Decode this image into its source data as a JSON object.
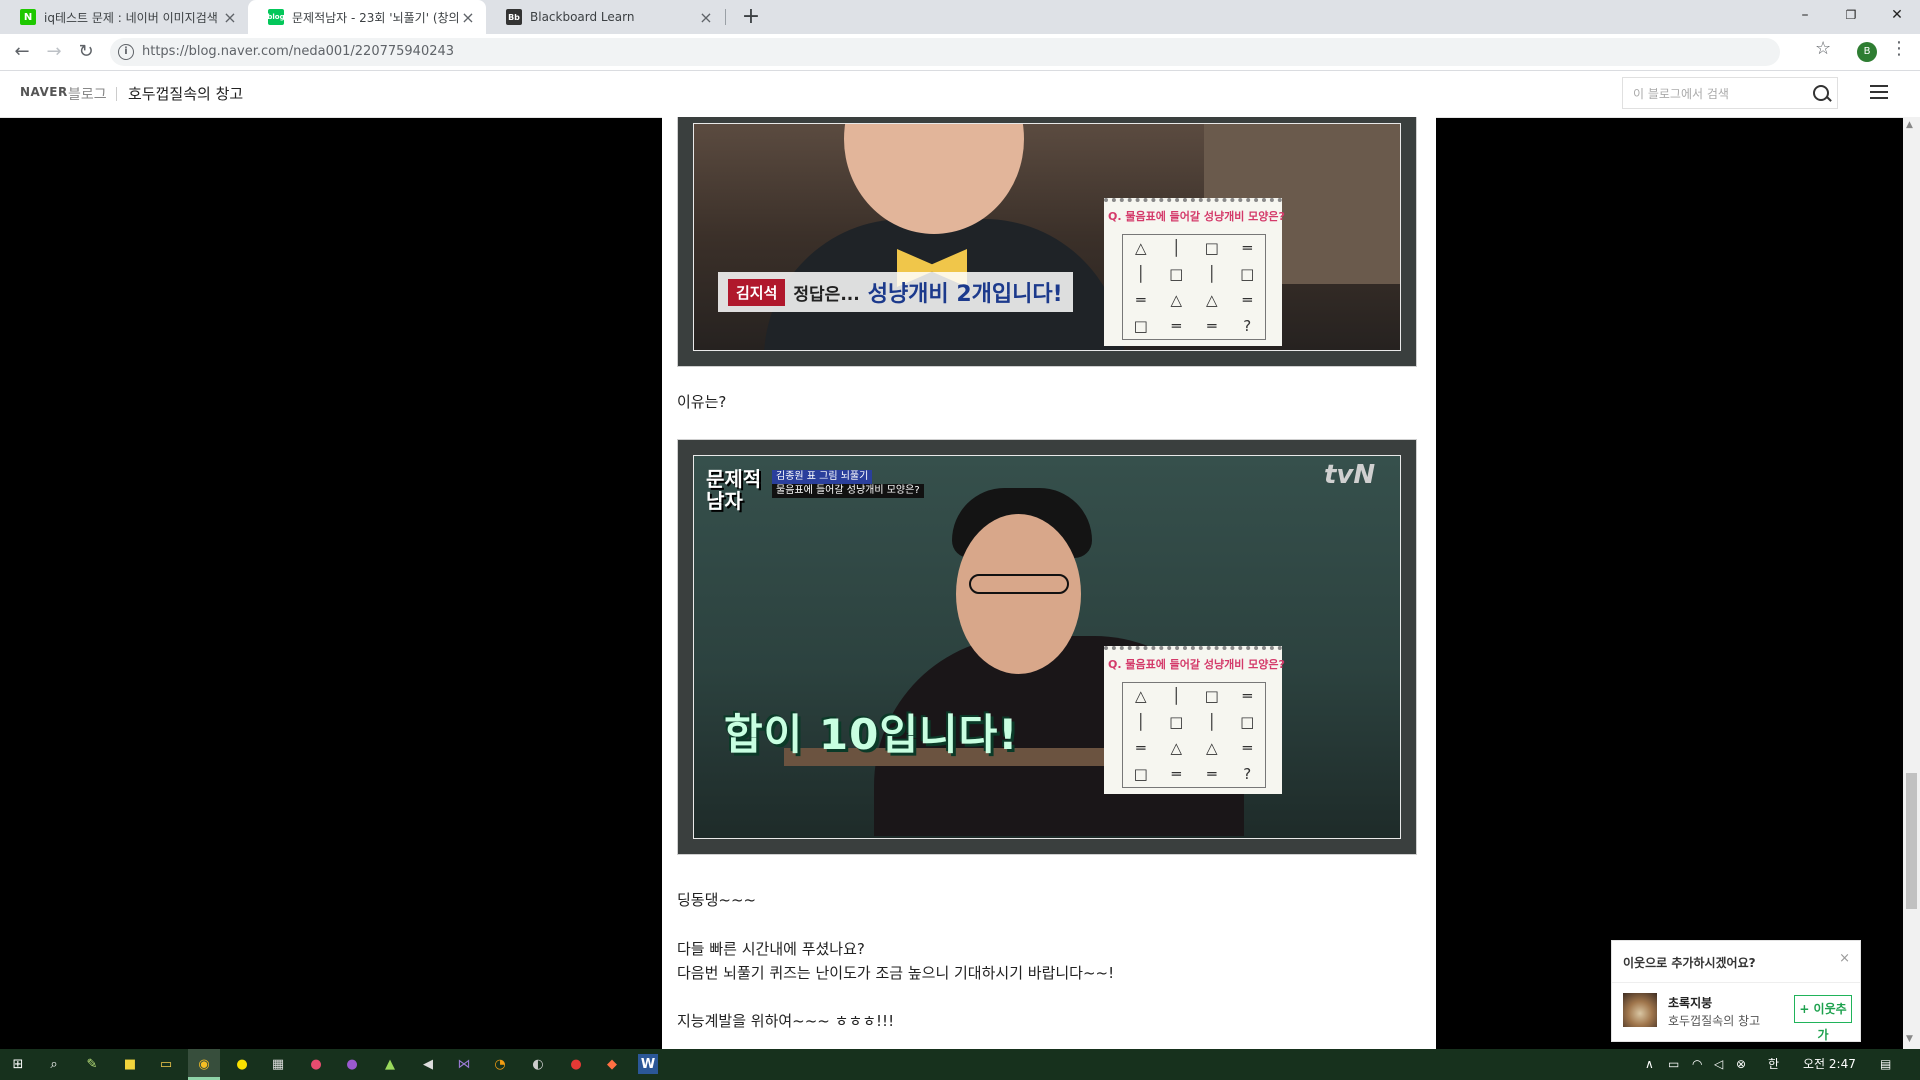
{
  "browser": {
    "tabs": [
      {
        "title": "iq테스트 문제 : 네이버 이미지검색",
        "favicon": "naver-n-icon"
      },
      {
        "title": "문제적남자 - 23회 '뇌풀기' (창의",
        "favicon": "naver-blog-icon"
      },
      {
        "title": "Blackboard Learn",
        "favicon": "blackboard-icon"
      }
    ],
    "new_tab": "+",
    "url": "https://blog.naver.com/neda001/220775940243",
    "profile_initial": "B",
    "window_controls": {
      "minimize": "–",
      "restore": "❐",
      "close": "✕"
    }
  },
  "blog_header": {
    "logo": "NAVER",
    "logo_sub": "블로그",
    "title": "호두껍질속의 창고",
    "search_placeholder": "이 블로그에서 검색"
  },
  "post": {
    "image1": {
      "caption_name": "김지석",
      "caption_prefix": "정답은...",
      "caption_text": "성냥개비 2개입니다!",
      "quiz_title": "물음표에 들어갈 성냥개비 모양은?",
      "quiz_q_mark": "Q.",
      "quiz_cells": [
        "△",
        "│",
        "□",
        "═",
        "│",
        "□",
        "│",
        "□",
        "═",
        "△",
        "△",
        "═",
        "□",
        "═",
        "═",
        "?"
      ]
    },
    "text1": "이유는?",
    "image2": {
      "show_logo_line1": "문제적",
      "show_logo_line2": "남자",
      "caption_top": "김종원 표 그림 뇌풀기",
      "caption_bottom": "물음표에 들어갈 성냥개비 모양은?",
      "channel": "tvN",
      "subtitle": "합이 10입니다!",
      "quiz_title": "물음표에 들어갈 성냥개비 모양은?",
      "quiz_q_mark": "Q.",
      "quiz_cells": [
        "△",
        "│",
        "□",
        "═",
        "│",
        "□",
        "│",
        "□",
        "═",
        "△",
        "△",
        "═",
        "□",
        "═",
        "═",
        "?"
      ]
    },
    "text2": "딩동댕~~~",
    "text3": "다들 빠른 시간내에 푸셨나요?",
    "text4": "다음번 뇌풀기 퀴즈는 난이도가 조금 높으니 기대하시기 바랍니다~~!",
    "text5": "지능계발을 위하여~~~ ㅎㅎㅎ!!!"
  },
  "neighbor_popup": {
    "title": "이웃으로 추가하시겠어요?",
    "close": "×",
    "name": "초록지붕",
    "blog": "호두껍질속의 창고",
    "button": "+ 이웃추가"
  },
  "taskbar": {
    "time": "오전 2:47",
    "ime": "한"
  },
  "colors": {
    "taskbar": "#17311d",
    "naver_green": "#1ea14e",
    "subtitle_blue": "#1c3a8c"
  }
}
